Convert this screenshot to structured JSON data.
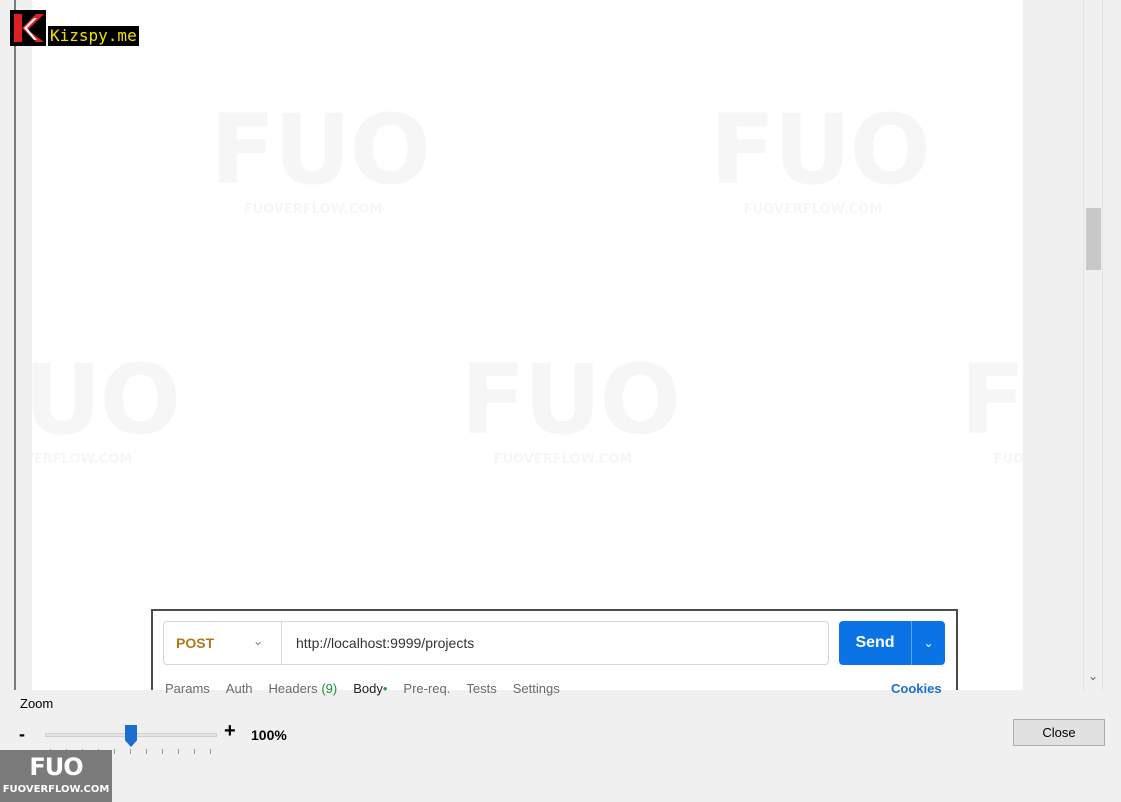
{
  "brand_badge": {
    "text": "Kizspy.me",
    "accent_color": "#f0e000",
    "icon": "k-logo-icon"
  },
  "watermark": {
    "logo": "FUO",
    "site": "FUOVERFLOW.COM"
  },
  "request": {
    "method": "POST",
    "method_color": "#b07a1a",
    "url": "http://localhost:9999/projects",
    "send_label": "Send",
    "send_color": "#0a74e6",
    "tabs": [
      {
        "label": "Params"
      },
      {
        "label": "Auth"
      },
      {
        "label": "Headers",
        "count": "(9)"
      },
      {
        "label": "Body",
        "indicator": "•"
      },
      {
        "label": "Pre-req."
      },
      {
        "label": "Tests"
      },
      {
        "label": "Settings"
      }
    ],
    "cookies_label": "Cookies"
  },
  "zoom": {
    "label": "Zoom",
    "minus": "-",
    "plus": "+",
    "value": "100%",
    "level_fraction": 0.5
  },
  "footer": {
    "close_label": "Close"
  },
  "corner_badge": {
    "logo": "FUO",
    "site": "FUOVERFLOW.COM"
  }
}
